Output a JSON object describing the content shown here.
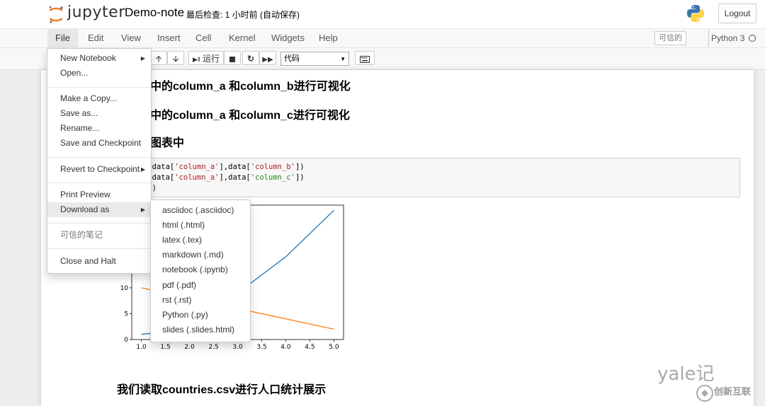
{
  "header": {
    "logo_text": "jupyter",
    "notebook_name": "Demo-note",
    "checkpoint_text": "最后检查: 1 小时前 (自动保存)",
    "logout_label": "Logout"
  },
  "menubar": {
    "items": [
      "File",
      "Edit",
      "View",
      "Insert",
      "Cell",
      "Kernel",
      "Widgets",
      "Help"
    ],
    "trusted_label": "可信的",
    "kernel_name": "Python 3"
  },
  "toolbar": {
    "run_label": "运行",
    "cell_type": "代码"
  },
  "file_menu": {
    "items": [
      "New Notebook",
      "Open...",
      "Make a Copy...",
      "Save as...",
      "Rename...",
      "Save and Checkpoint",
      "Revert to Checkpoint",
      "Print Preview",
      "Download as",
      "可信的笔记",
      "Close and Halt"
    ]
  },
  "download_menu": {
    "items": [
      "asciidoc (.asciidoc)",
      "html (.html)",
      "latex (.tex)",
      "markdown (.md)",
      "notebook (.ipynb)",
      "pdf (.pdf)",
      "rst (.rst)",
      "Python (.py)",
      "slides (.slides.html)"
    ]
  },
  "notebook": {
    "headings": [
      "中的column_a 和column_b进行可视化",
      "中的column_a 和column_c进行可视化",
      "图表中"
    ],
    "code_lines": [
      {
        "pre": "t(data[",
        "s1": "'column_a'",
        "mid": "],data[",
        "s2": "'column_b'",
        "post": "])"
      },
      {
        "pre": "t(data[",
        "s1": "'column_a'",
        "mid": "],data[",
        "s2": "'column_c'",
        "post": "])"
      },
      {
        "pre": "w()",
        "s1": "",
        "mid": "",
        "s2": "",
        "post": ""
      }
    ],
    "bottom_heading": "我们读取countries.csv进行人口统计展示"
  },
  "chart_data": {
    "type": "line",
    "x": [
      1,
      2,
      3,
      4,
      5
    ],
    "series": [
      {
        "color": "#1f77b4",
        "values": [
          1,
          2,
          9,
          16,
          25
        ]
      },
      {
        "color": "#ff7f0e",
        "values": [
          10,
          8,
          6,
          4,
          2
        ]
      }
    ],
    "xlim": [
      0.8,
      5.2
    ],
    "ylim": [
      0,
      26
    ],
    "x_ticks": [
      "1.0",
      "1.5",
      "2.0",
      "2.5",
      "3.0",
      "3.5",
      "4.0",
      "4.5",
      "5.0"
    ],
    "y_ticks": [
      "0",
      "5",
      "10"
    ]
  },
  "watermark": {
    "text1": "yale记",
    "text2": "创新互联"
  }
}
